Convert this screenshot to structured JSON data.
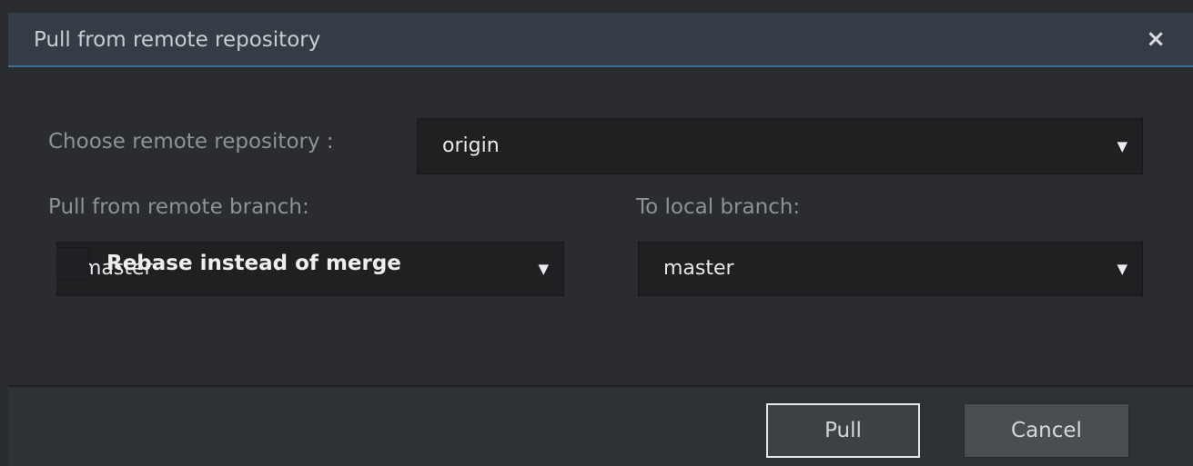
{
  "dialog": {
    "title": "Pull from remote repository",
    "close_glyph": "×",
    "close_icon": "close-icon"
  },
  "form": {
    "remote_label": "Choose remote repository :",
    "remote_value": "origin",
    "remote_branch_label": "Pull from remote branch:",
    "remote_branch_value": "master",
    "local_branch_label": "To local branch:",
    "local_branch_value": "master",
    "caret_glyph": "▼",
    "caret_icon": "caret-down-icon",
    "rebase_label": "Rebase instead of merge",
    "rebase_checked": false
  },
  "buttons": {
    "pull_label": "Pull",
    "cancel_label": "Cancel"
  },
  "colors": {
    "title_bar": "#343c45",
    "title_accent": "#3a6f96",
    "background": "#2a2c2f",
    "field_bg": "#1f2022"
  }
}
